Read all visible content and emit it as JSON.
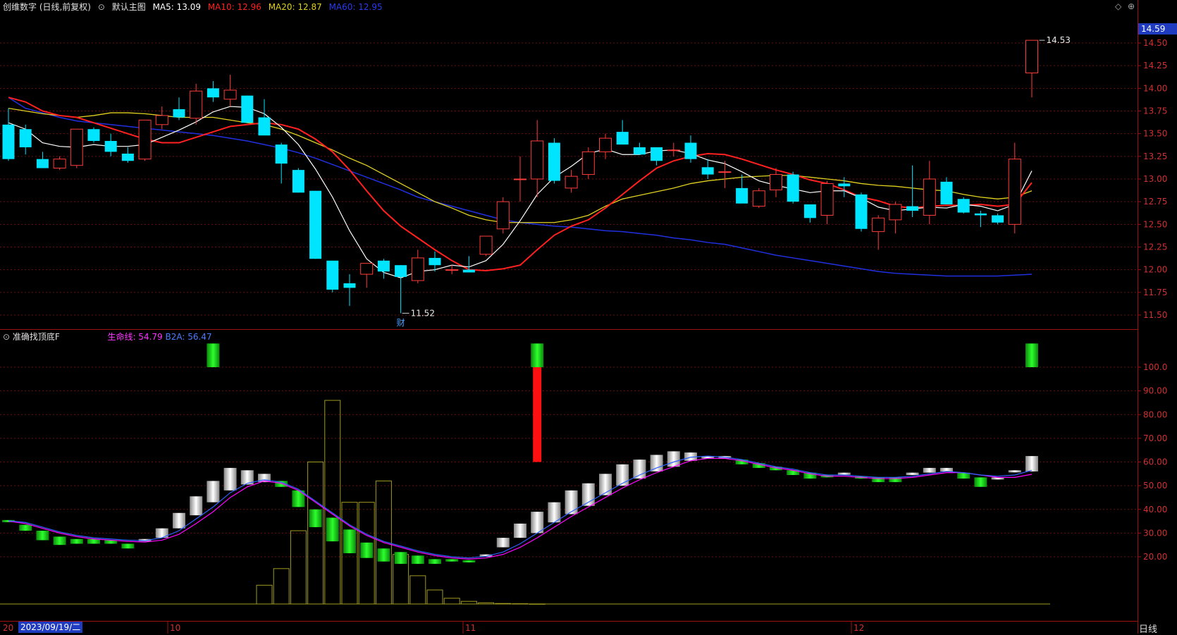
{
  "header": {
    "stock_name": "创维数字 (日线,前复权)",
    "main_chart_label": "默认主图",
    "ma5": "MA5: 13.09",
    "ma10": "MA10: 12.96",
    "ma20": "MA20: 12.87",
    "ma60": "MA60: 12.95"
  },
  "indicator": {
    "name": "准确找顶底F",
    "lifeline": "生命线: 54.79",
    "b2a": "B2A: 56.47"
  },
  "price_axis": [
    "14.50",
    "14.25",
    "14.00",
    "13.75",
    "13.50",
    "13.25",
    "13.00",
    "12.75",
    "12.50",
    "12.25",
    "12.00",
    "11.75",
    "11.50"
  ],
  "indicator_axis": [
    "100.0",
    "90.00",
    "80.00",
    "70.00",
    "60.00",
    "50.00",
    "40.00",
    "30.00",
    "20.00"
  ],
  "last_price": "14.59",
  "high_marker": "14.53",
  "low_marker": "11.52",
  "event_marker": "财",
  "date_axis": {
    "selected_date": "2023/09/19/二",
    "start_label": "20",
    "labels": [
      "10",
      "11",
      "12"
    ],
    "period": "日线"
  },
  "colors": {
    "up": "#ff3b3b",
    "down": "#00e5ff",
    "ma5": "#ffffff",
    "ma10": "#ff2020",
    "ma20": "#e0d020",
    "ma60": "#2030e0",
    "lifeline": "#ff00ff",
    "b2a": "#3060ff"
  },
  "candles": [
    [
      13.6,
      13.78,
      13.2,
      13.22
    ],
    [
      13.55,
      13.6,
      13.27,
      13.35
    ],
    [
      13.22,
      13.3,
      13.12,
      13.12
    ],
    [
      13.12,
      13.25,
      13.1,
      13.22
    ],
    [
      13.15,
      13.55,
      13.12,
      13.55
    ],
    [
      13.55,
      13.57,
      13.4,
      13.42
    ],
    [
      13.42,
      13.5,
      13.25,
      13.3
    ],
    [
      13.28,
      13.35,
      13.18,
      13.2
    ],
    [
      13.22,
      13.65,
      13.2,
      13.65
    ],
    [
      13.6,
      13.8,
      13.55,
      13.7
    ],
    [
      13.77,
      13.9,
      13.65,
      13.68
    ],
    [
      13.67,
      14.05,
      13.6,
      13.97
    ],
    [
      14.0,
      14.08,
      13.85,
      13.9
    ],
    [
      13.88,
      14.15,
      13.8,
      13.98
    ],
    [
      13.92,
      13.92,
      13.62,
      13.62
    ],
    [
      13.68,
      13.88,
      13.5,
      13.48
    ],
    [
      13.38,
      13.4,
      12.95,
      13.17
    ],
    [
      13.1,
      13.12,
      12.85,
      12.85
    ],
    [
      12.87,
      12.87,
      12.12,
      12.12
    ],
    [
      12.1,
      12.1,
      11.75,
      11.78
    ],
    [
      11.85,
      11.95,
      11.6,
      11.8
    ],
    [
      11.95,
      12.07,
      11.8,
      12.07
    ],
    [
      12.1,
      12.12,
      11.9,
      11.98
    ],
    [
      12.05,
      12.05,
      11.52,
      11.92
    ],
    [
      11.88,
      12.22,
      11.85,
      12.13
    ],
    [
      12.13,
      12.2,
      11.98,
      12.05
    ],
    [
      12.0,
      12.05,
      11.95,
      12.0
    ],
    [
      12.0,
      12.15,
      11.97,
      11.97
    ],
    [
      12.17,
      12.3,
      12.15,
      12.37
    ],
    [
      12.45,
      12.8,
      12.4,
      12.75
    ],
    [
      13.0,
      13.25,
      12.75,
      13.0
    ],
    [
      13.0,
      13.65,
      12.8,
      13.42
    ],
    [
      13.4,
      13.45,
      12.95,
      12.98
    ],
    [
      12.9,
      13.1,
      12.85,
      13.03
    ],
    [
      13.05,
      13.35,
      13.0,
      13.3
    ],
    [
      13.3,
      13.5,
      13.22,
      13.45
    ],
    [
      13.52,
      13.65,
      13.38,
      13.38
    ],
    [
      13.35,
      13.4,
      13.28,
      13.27
    ],
    [
      13.35,
      13.35,
      13.15,
      13.2
    ],
    [
      13.32,
      13.4,
      13.25,
      13.32
    ],
    [
      13.4,
      13.48,
      13.18,
      13.22
    ],
    [
      13.13,
      13.22,
      13.0,
      13.05
    ],
    [
      13.08,
      13.2,
      12.9,
      13.08
    ],
    [
      12.9,
      13.05,
      12.75,
      12.73
    ],
    [
      12.7,
      12.9,
      12.68,
      12.87
    ],
    [
      12.88,
      13.12,
      12.8,
      13.05
    ],
    [
      13.05,
      13.08,
      12.73,
      12.75
    ],
    [
      12.72,
      12.72,
      12.52,
      12.57
    ],
    [
      12.6,
      12.98,
      12.5,
      12.95
    ],
    [
      12.95,
      13.02,
      12.8,
      12.92
    ],
    [
      12.83,
      12.85,
      12.42,
      12.45
    ],
    [
      12.42,
      12.6,
      12.22,
      12.57
    ],
    [
      12.55,
      12.75,
      12.4,
      12.72
    ],
    [
      12.7,
      13.15,
      12.58,
      12.65
    ],
    [
      12.6,
      13.2,
      12.5,
      13.0
    ],
    [
      12.97,
      13.02,
      12.72,
      12.72
    ],
    [
      12.78,
      12.8,
      12.62,
      12.63
    ],
    [
      12.62,
      12.65,
      12.47,
      12.6
    ],
    [
      12.6,
      12.62,
      12.5,
      12.52
    ],
    [
      12.5,
      13.4,
      12.4,
      13.22
    ],
    [
      14.17,
      14.53,
      13.9,
      14.53
    ]
  ],
  "ma": {
    "ma5": [
      13.62,
      13.55,
      13.4,
      13.36,
      13.35,
      13.38,
      13.36,
      13.36,
      13.38,
      13.46,
      13.54,
      13.63,
      13.74,
      13.8,
      13.79,
      13.72,
      13.57,
      13.38,
      13.11,
      12.8,
      12.43,
      12.12,
      11.97,
      11.91,
      11.98,
      12.0,
      12.05,
      12.03,
      12.1,
      12.28,
      12.54,
      12.83,
      13.02,
      13.14,
      13.28,
      13.33,
      13.27,
      13.27,
      13.31,
      13.32,
      13.28,
      13.21,
      13.17,
      13.08,
      12.98,
      12.93,
      12.89,
      12.85,
      12.87,
      12.87,
      12.79,
      12.69,
      12.65,
      12.67,
      12.69,
      12.68,
      12.72,
      12.7,
      12.65,
      12.72,
      13.09
    ],
    "ma10": [
      13.9,
      13.85,
      13.75,
      13.7,
      13.68,
      13.62,
      13.56,
      13.5,
      13.44,
      13.4,
      13.4,
      13.46,
      13.52,
      13.58,
      13.6,
      13.62,
      13.6,
      13.55,
      13.44,
      13.3,
      13.1,
      12.87,
      12.65,
      12.48,
      12.35,
      12.22,
      12.1,
      12.0,
      11.99,
      12.01,
      12.05,
      12.22,
      12.38,
      12.48,
      12.55,
      12.68,
      12.83,
      12.98,
      13.12,
      13.2,
      13.25,
      13.28,
      13.27,
      13.22,
      13.16,
      13.1,
      13.05,
      12.99,
      12.95,
      12.88,
      12.8,
      12.76,
      12.7,
      12.68,
      12.7,
      12.71,
      12.71,
      12.72,
      12.7,
      12.72,
      12.96
    ],
    "ma20": [
      13.78,
      13.75,
      13.72,
      13.7,
      13.68,
      13.7,
      13.73,
      13.73,
      13.72,
      13.7,
      13.68,
      13.68,
      13.68,
      13.65,
      13.62,
      13.6,
      13.55,
      13.48,
      13.4,
      13.32,
      13.23,
      13.15,
      13.05,
      12.95,
      12.85,
      12.75,
      12.68,
      12.6,
      12.55,
      12.52,
      12.52,
      12.52,
      12.52,
      12.55,
      12.6,
      12.7,
      12.78,
      12.82,
      12.86,
      12.9,
      12.95,
      12.98,
      13.0,
      13.02,
      13.03,
      13.04,
      13.04,
      13.02,
      13.0,
      12.98,
      12.95,
      12.93,
      12.92,
      12.9,
      12.88,
      12.87,
      12.83,
      12.8,
      12.78,
      12.8,
      12.87
    ],
    "ma60": [
      13.9,
      13.78,
      13.73,
      13.68,
      13.64,
      13.62,
      13.6,
      13.58,
      13.56,
      13.54,
      13.52,
      13.5,
      13.48,
      13.45,
      13.42,
      13.38,
      13.34,
      13.29,
      13.23,
      13.16,
      13.09,
      13.02,
      12.95,
      12.88,
      12.8,
      12.75,
      12.7,
      12.65,
      12.6,
      12.55,
      12.52,
      12.5,
      12.48,
      12.47,
      12.45,
      12.43,
      12.42,
      12.4,
      12.38,
      12.35,
      12.33,
      12.3,
      12.28,
      12.24,
      12.2,
      12.16,
      12.13,
      12.1,
      12.07,
      12.04,
      12.01,
      11.98,
      11.96,
      11.95,
      11.94,
      11.93,
      11.93,
      11.93,
      11.93,
      11.94,
      11.95
    ]
  },
  "ind_bars": [
    [
      35.5,
      35.2,
      "g"
    ],
    [
      33.5,
      31.0,
      "g"
    ],
    [
      31.0,
      27.0,
      "g"
    ],
    [
      28.5,
      25.0,
      "g"
    ],
    [
      27.5,
      25.5,
      "g"
    ],
    [
      27.5,
      25.5,
      "g"
    ],
    [
      27.0,
      25.5,
      "g"
    ],
    [
      25.5,
      23.5,
      "g"
    ],
    [
      27.5,
      26.5,
      "w"
    ],
    [
      28.0,
      32.0,
      "w"
    ],
    [
      32.0,
      38.5,
      "w"
    ],
    [
      37.5,
      45.5,
      "w"
    ],
    [
      43.0,
      52.0,
      "w"
    ],
    [
      48.0,
      57.5,
      "w"
    ],
    [
      56.5,
      50.5,
      "w"
    ],
    [
      55.0,
      51.5,
      "w"
    ],
    [
      52.0,
      49.5,
      "g"
    ],
    [
      48.0,
      41.0,
      "g"
    ],
    [
      40.0,
      32.5,
      "g"
    ],
    [
      36.5,
      26.5,
      "g"
    ],
    [
      31.5,
      21.5,
      "g"
    ],
    [
      26.0,
      19.5,
      "g"
    ],
    [
      23.5,
      18.0,
      "g"
    ],
    [
      22.0,
      17.0,
      "g"
    ],
    [
      20.5,
      17.0,
      "g"
    ],
    [
      19.0,
      17.0,
      "g"
    ],
    [
      19.0,
      18.0,
      "g"
    ],
    [
      18.5,
      18.5,
      "g"
    ],
    [
      20.0,
      21.0,
      "w"
    ],
    [
      24.0,
      28.0,
      "w"
    ],
    [
      28.0,
      34.0,
      "w"
    ],
    [
      30.0,
      39.0,
      "w"
    ],
    [
      34.5,
      43.0,
      "w"
    ],
    [
      38.0,
      48.0,
      "w"
    ],
    [
      41.5,
      51.0,
      "w"
    ],
    [
      46.0,
      55.0,
      "w"
    ],
    [
      50.0,
      59.0,
      "w"
    ],
    [
      53.0,
      61.0,
      "w"
    ],
    [
      56.0,
      63.0,
      "w"
    ],
    [
      58.0,
      64.5,
      "w"
    ],
    [
      60.5,
      64.0,
      "w"
    ],
    [
      61.5,
      62.5,
      "w"
    ],
    [
      62.5,
      61.5,
      "w"
    ],
    [
      61.0,
      59.0,
      "g"
    ],
    [
      59.5,
      57.5,
      "g"
    ],
    [
      58.0,
      56.5,
      "g"
    ],
    [
      56.5,
      54.5,
      "g"
    ],
    [
      55.5,
      53.0,
      "g"
    ],
    [
      54.5,
      53.5,
      "g"
    ],
    [
      55.0,
      55.5,
      "w"
    ],
    [
      54.0,
      53.0,
      "g"
    ],
    [
      53.5,
      51.5,
      "g"
    ],
    [
      53.5,
      51.5,
      "g"
    ],
    [
      54.5,
      55.5,
      "w"
    ],
    [
      55.5,
      57.5,
      "w"
    ],
    [
      56.0,
      57.5,
      "w"
    ],
    [
      55.5,
      53.0,
      "g"
    ],
    [
      53.5,
      49.5,
      "g"
    ],
    [
      53.0,
      53.5,
      "w"
    ],
    [
      56.5,
      56.5,
      "w"
    ],
    [
      56.0,
      62.5,
      "w"
    ]
  ],
  "ind_lines": {
    "lifeline": [
      35,
      34,
      32,
      30,
      28.5,
      27.5,
      27,
      26.5,
      26.2,
      27,
      29.5,
      34,
      39,
      45,
      49.5,
      52,
      51,
      48,
      43,
      38,
      33,
      29,
      26,
      24,
      22,
      20.5,
      19.5,
      19,
      19.5,
      21,
      24,
      28,
      32.5,
      37,
      41,
      45,
      49,
      52.5,
      55.5,
      58,
      60.5,
      61.5,
      61.5,
      60.5,
      59,
      57.5,
      56.5,
      55,
      54,
      54,
      53.5,
      53,
      53,
      53.5,
      54.5,
      55.5,
      55.5,
      54.5,
      53.5,
      53.5,
      54.8
    ],
    "b2a": [
      35.2,
      34.5,
      32.5,
      30.5,
      29,
      28,
      27.5,
      27,
      26.8,
      28,
      31,
      36,
      41,
      47,
      51,
      52.5,
      51.5,
      48.5,
      43.5,
      38.5,
      33.5,
      29.5,
      26.5,
      24.5,
      22.5,
      21,
      20,
      19.5,
      20.2,
      22,
      25.5,
      30,
      34.5,
      39,
      43,
      47,
      51,
      54.5,
      57.5,
      60,
      62,
      62.5,
      62,
      61,
      59.5,
      58,
      57,
      55.5,
      54.5,
      54.5,
      54,
      53.5,
      53.5,
      54,
      55,
      56,
      55.5,
      54.5,
      54,
      54.5,
      56.5
    ]
  },
  "ind_signals": {
    "green_top_indices": [
      12,
      31,
      60
    ],
    "red_bar_index": 31,
    "red_bar_range": [
      60,
      100
    ]
  },
  "outline_bars": [
    [
      15,
      8
    ],
    [
      16,
      15
    ],
    [
      17,
      31
    ],
    [
      18,
      60
    ],
    [
      19,
      86
    ],
    [
      20,
      43
    ],
    [
      21,
      43
    ],
    [
      22,
      52
    ],
    [
      23,
      21
    ],
    [
      24,
      12
    ],
    [
      25,
      6
    ],
    [
      26,
      2.5
    ],
    [
      27,
      1.2
    ],
    [
      28,
      0.6
    ],
    [
      29,
      0.3
    ],
    [
      30,
      0.2
    ],
    [
      31,
      0.1
    ]
  ]
}
